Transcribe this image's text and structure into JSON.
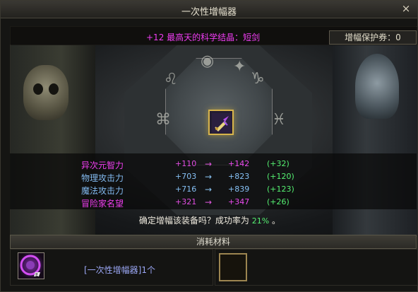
{
  "window": {
    "title": "一次性增幅器",
    "close_label": "×"
  },
  "top": {
    "item_name": "+12 最高天的科学结晶：短剑",
    "protect_label": "增幅保护券：0"
  },
  "stats": [
    {
      "name": "异次元智力",
      "old": "+110",
      "arrow": "→",
      "new": "+142",
      "diff": "(+32)"
    },
    {
      "name": "物理攻击力",
      "old": "+703",
      "arrow": "→",
      "new": "+823",
      "diff": "(+120)"
    },
    {
      "name": "魔法攻击力",
      "old": "+716",
      "arrow": "→",
      "new": "+839",
      "diff": "(+123)"
    },
    {
      "name": "冒险家名望",
      "old": "+321",
      "arrow": "→",
      "new": "+347",
      "diff": "(+26)"
    }
  ],
  "confirm": {
    "text_before": "确定增幅该装备吗？成功率为",
    "rate": "21%",
    "text_after": "。"
  },
  "materials": {
    "header": "消耗材料",
    "item_text": "[一次性增幅器]1个"
  },
  "icons": {
    "close": "close-icon",
    "equipment": "short-sword-icon",
    "material": "amplifier-orb-icon"
  }
}
